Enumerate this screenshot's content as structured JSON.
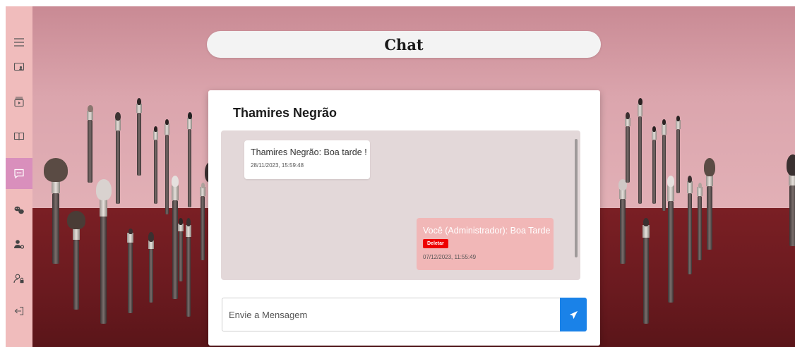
{
  "page": {
    "title": "Chat"
  },
  "sidebar": {
    "items": [
      {
        "icon": "menu-icon"
      },
      {
        "icon": "screen-user-icon"
      },
      {
        "icon": "video-icon"
      },
      {
        "icon": "book-icon"
      },
      {
        "icon": "chat-icon",
        "active": true
      },
      {
        "icon": "paw-icon"
      },
      {
        "icon": "user-settings-icon"
      },
      {
        "icon": "user-lock-icon"
      },
      {
        "icon": "logout-icon"
      }
    ],
    "active_color": "#d98fbc",
    "background_color": "#f0bcbc"
  },
  "chat": {
    "contact_name": "Thamires Negrão",
    "messages": [
      {
        "direction": "incoming",
        "text": "Thamires Negrão: Boa tarde !",
        "timestamp": "28/11/2023, 15:59:48"
      },
      {
        "direction": "outgoing",
        "text": "Você (Administrador): Boa Tarde",
        "delete_label": "Deletar",
        "timestamp": "07/12/2023, 11:55:49"
      }
    ],
    "input": {
      "placeholder": "Envie a Mensagem",
      "value": ""
    },
    "send_icon": "paper-plane-icon"
  },
  "colors": {
    "send_button": "#1a82e8",
    "delete_button": "#ee0000",
    "outgoing_bubble": "#f1b7b7",
    "messages_area": "#e3d8d9"
  }
}
